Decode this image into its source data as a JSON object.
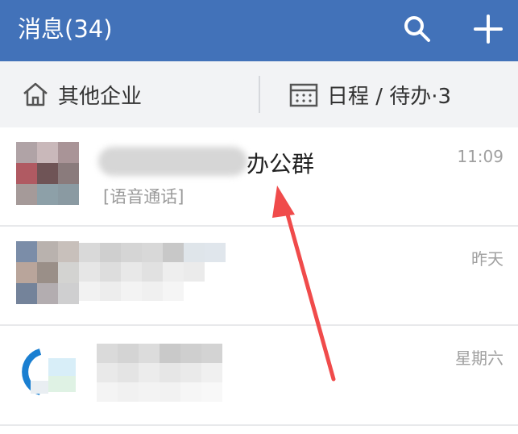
{
  "header": {
    "title": "消息(34)",
    "icons": [
      "search-icon",
      "plus-icon"
    ]
  },
  "subbar": {
    "enterprise_label": "其他企业",
    "enterprise_icon": "home-icon",
    "schedule_label": "日程 / 待办·3",
    "schedule_icon": "calendar-icon"
  },
  "conversations": [
    {
      "name_visible": "办公群",
      "preview": "[语音通话]",
      "time": "11:09"
    },
    {
      "time": "昨天"
    },
    {
      "time": "星期六"
    }
  ],
  "colors": {
    "header_bg": "#4272b9",
    "subbar_bg": "#f2f3f5",
    "annotation_arrow": "#f04b4b"
  }
}
